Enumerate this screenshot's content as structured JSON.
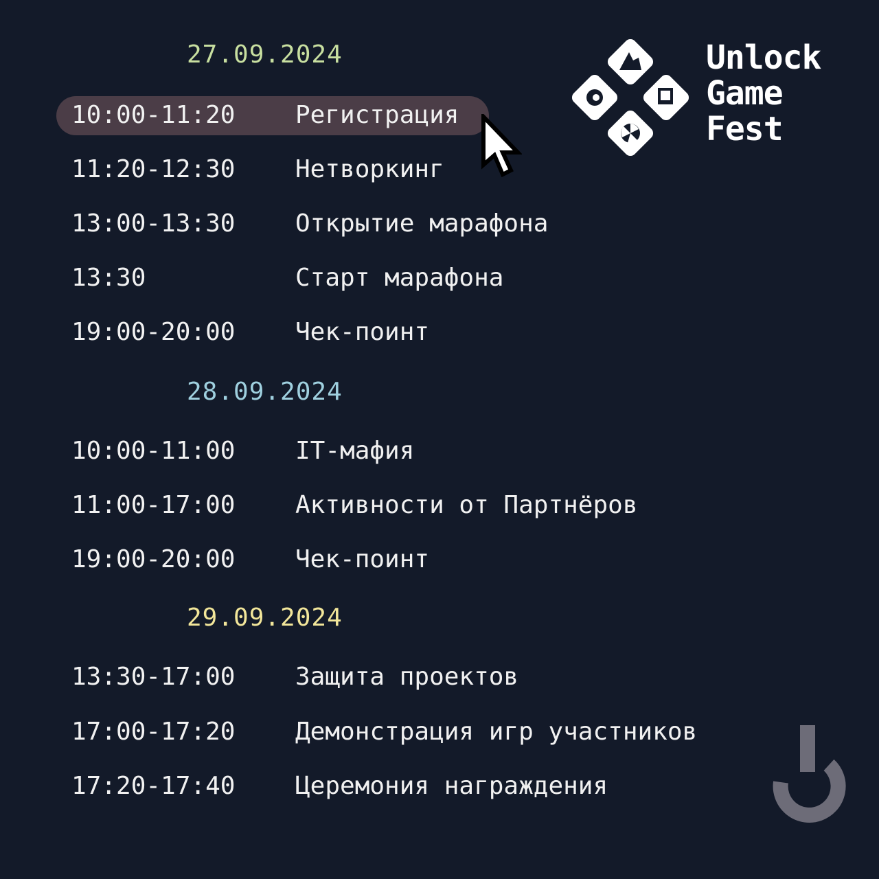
{
  "branding": {
    "logo_lines": [
      "Unlock",
      "Game",
      "Fest"
    ]
  },
  "colors": {
    "background": "#131a29",
    "text": "#f1f1f1",
    "highlight": "#4b3d47",
    "day1": "#c8dfa0",
    "day2": "#9fd0df",
    "day3": "#f2e69a",
    "corner_mark": "#6d6c78"
  },
  "schedule": [
    {
      "date": "27.09.2024",
      "items": [
        {
          "time": "10:00-11:20",
          "event": "Регистрация",
          "highlighted": true
        },
        {
          "time": "11:20-12:30",
          "event": "Нетворкинг"
        },
        {
          "time": "13:00-13:30",
          "event": "Открытие марафона"
        },
        {
          "time": "13:30",
          "event": "Старт марафона"
        },
        {
          "time": "19:00-20:00",
          "event": "Чек-поинт"
        }
      ]
    },
    {
      "date": "28.09.2024",
      "items": [
        {
          "time": "10:00-11:00",
          "event": "IT-мафия"
        },
        {
          "time": "11:00-17:00",
          "event": "Активности от Партнёров"
        },
        {
          "time": "19:00-20:00",
          "event": "Чек-поинт"
        }
      ]
    },
    {
      "date": "29.09.2024",
      "items": [
        {
          "time": "13:30-17:00",
          "event": "Защита проектов"
        },
        {
          "time": "17:00-17:20",
          "event": "Демонстрация игр участников"
        },
        {
          "time": "17:20-17:40",
          "event": "Церемония награждения"
        }
      ]
    }
  ],
  "icons": {
    "cursor": "mouse-pointer-icon",
    "logo": "gamepad-diamond-icon",
    "corner": "power-hook-icon"
  }
}
